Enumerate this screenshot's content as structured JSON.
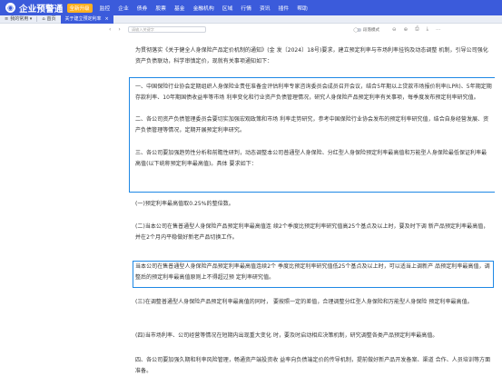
{
  "app": {
    "name": "企业预警通",
    "pro_label": "全新升级",
    "nav": [
      "监控",
      "企业",
      "债券",
      "股票",
      "基金",
      "金融机构",
      "区域",
      "行情",
      "资讯",
      "插件",
      "帮助"
    ]
  },
  "tabs": [
    {
      "label": "我的常用 ▾"
    },
    {
      "label": "首页"
    },
    {
      "label": "关于建立预定利率"
    }
  ],
  "toolbar": {
    "search_placeholder": "请输入关键字",
    "toggle_label": "段落模式"
  },
  "document": {
    "intro": "为贯彻落实《关于健全人身保险产品定价机制的通知》(金 发〔2024〕18号)要求，建立预定利率与市场利率挂钩及动态调整 机制，引导公司强化资产负债联动，科学审慎定价，现就有关事项通知如下：",
    "item1": "一、中国保险行业协会定期组织人身保险业责任准备金评估利率专家咨询委员会成员召开会议，结合5年期以上贷款市场报价利率(LPR)、5年期定期存款利率、10年期国债收益率等市场 利率变化和行业资产负债管理情况，研究人身保险产品预定利率有关事项，每季度发布预定利率研究值。",
    "item2": "二、各公司资产负债管理委员会要切实加强宏观政策和市场 利率走势研究，参考中国保险行业协会发布的预定利率研究值，结合自身经营发展、资产负债管理等情况，定期开展预定利率研究。",
    "item3": "三、各公司要加强趋势性分析和前瞻性研判，动态调整本公司普通型人身保险、分红型人身保险预定利率最高值和万能型人身保险最低保证利率最高值(以下统称预定利率最高值)。具体 要求如下：",
    "sub1": "(一)预定利率最高值取0.25%的整倍数。",
    "sub2": "(二)当本公司在售普通型人身保险产品预定利率最高值连 续2个季度比预定利率研究值高25个基点及以上时，要及时下调 新产品预定利率最高值，并在2个月内平稳做好新老产品切换工作。",
    "highlight": "当本公司在售普通型人身保险产品预定利率最高值连续2个 季度比预定利率研究值低25个基点及以上时，可以适当上调新产 品预定利率最高值，调整后的预定利率最高值原则上不得超过预 定利率研究值。",
    "sub3": "(三)在调整普通型人身保险产品预定利率最高值的同时， 要按照一定的差值，合理调整分红型人身保险和万能型人身保险 预定利率最高值。",
    "sub4": "(四)当市场利率、公司经营等情况在短期内出现重大变化 时，要及时启动相应决策机制，研究调整各类产品预定利率最高值。",
    "item4": "四、各公司要加强久期和利率风险管理，畅通资产端投资收 益率向负债端定价的传导机制，提前做好新产品开发备案、渠道 合作、人员培训等方面准备。"
  }
}
